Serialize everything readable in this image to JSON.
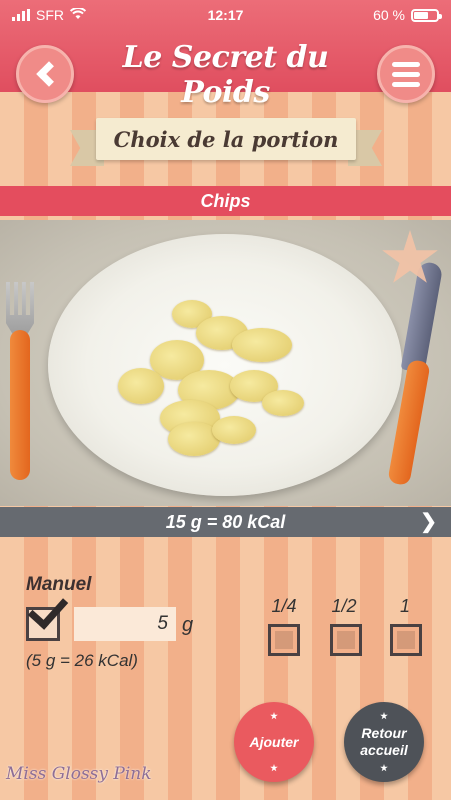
{
  "status_bar": {
    "carrier": "SFR",
    "time": "12:17",
    "battery": "60 %"
  },
  "header": {
    "title": "Le Secret du Poids",
    "back_icon": "chevron-left-icon",
    "menu_icon": "hamburger-menu-icon"
  },
  "page": {
    "heading": "Choix de la portion"
  },
  "food": {
    "name": "Chips",
    "portion_summary": "15 g = 80 kCal"
  },
  "manual": {
    "label": "Manuel",
    "checked": true,
    "value": "5",
    "unit": "g",
    "info": "(5 g = 26 kCal)"
  },
  "fractions": [
    {
      "label": "1/4"
    },
    {
      "label": "1/2"
    },
    {
      "label": "1"
    }
  ],
  "actions": {
    "add": "Ajouter",
    "home_line1": "Retour",
    "home_line2": "accueil"
  },
  "brand": "Miss Glossy Pink",
  "colors": {
    "header": "#e04e5f",
    "portion_bar": "#666a70",
    "stripe_light": "#f6c8a4",
    "stripe_dark": "#f2b08a"
  }
}
